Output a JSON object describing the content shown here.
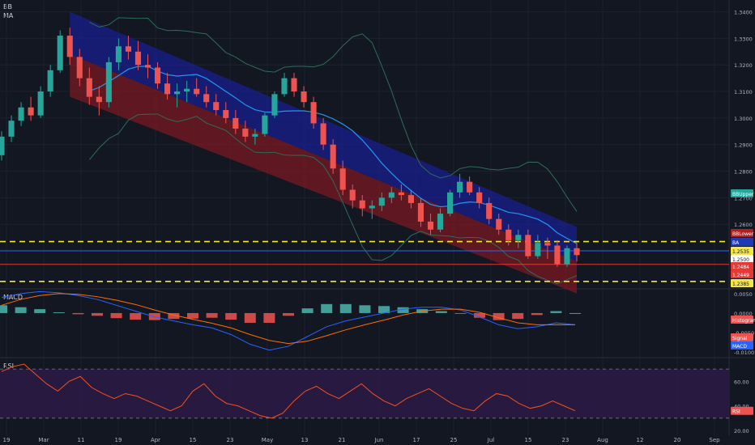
{
  "panes": {
    "price": {
      "labels": [
        "BB",
        "MA"
      ]
    },
    "macd": {
      "label": "MACD"
    },
    "rsi": {
      "label": "RSI"
    }
  },
  "x_axis": {
    "ticks": [
      "19",
      "Mar",
      "11",
      "19",
      "Apr",
      "15",
      "23",
      "May",
      "13",
      "21",
      "Jun",
      "17",
      "25",
      "Jul",
      "15",
      "23",
      "Aug",
      "12",
      "20",
      "Sep"
    ]
  },
  "price_axis": {
    "ticks": [
      "1.3400",
      "1.3300",
      "1.3200",
      "1.3100",
      "1.3000",
      "1.2900",
      "1.2800",
      "1.2700",
      "1.2600",
      "1.2500"
    ]
  },
  "macd_axis": {
    "ticks": [
      "0.0050",
      "0.0000",
      "-0.0050",
      "-0.0100"
    ]
  },
  "rsi_axis": {
    "ticks": [
      "60.00",
      "40.00",
      "20.00"
    ]
  },
  "badges": {
    "price": [
      {
        "text": "BBUpper",
        "bg": "#26a69a"
      },
      {
        "text": "BBLower",
        "bg": "#b71c1c"
      },
      {
        "text": "BA",
        "bg": "#1e3bb3"
      },
      {
        "text": "1.2535",
        "bg": "#f5e642"
      },
      {
        "text": "1.2500",
        "bg": "#ffffff"
      },
      {
        "text": "1.2484",
        "bg": "#e53935"
      },
      {
        "text": "1.2449",
        "bg": "#e53935"
      },
      {
        "text": "1.2385",
        "bg": "#f5e642"
      }
    ],
    "macd": [
      {
        "text": "Histogram",
        "bg": "#ef5350"
      },
      {
        "text": "Signal",
        "bg": "#ef5350"
      },
      {
        "text": "MACD",
        "bg": "#2962ff"
      }
    ],
    "rsi": [
      {
        "text": "RSI",
        "bg": "#ef5350"
      }
    ]
  },
  "colors": {
    "background": "#131722",
    "bull": "#26a69a",
    "bear": "#ef5350",
    "upper_channel": "#1a1f8f",
    "lower_channel": "#7a1a22",
    "bb_line": "#2e6b58",
    "ma_line": "#2196f3",
    "macd_line": "#2962ff",
    "signal_line": "#ff6d00",
    "rsi_line": "#f4511e",
    "rsi_band": "#2a1a44",
    "level_dashed": "#f5e642",
    "level_solid_blue": "#2962ff",
    "level_solid_red": "#e53935"
  },
  "chart_data": {
    "type": "candlestick",
    "symbol_pair_axis": "price",
    "ylim": [
      1.236,
      1.342
    ],
    "horizontal_levels": [
      {
        "value": 1.2535,
        "style": "dashed",
        "color": "#f5e642"
      },
      {
        "value": 1.25,
        "style": "solid",
        "color": "#2962ff"
      },
      {
        "value": 1.2449,
        "style": "solid",
        "color": "#e53935"
      },
      {
        "value": 1.2385,
        "style": "dashed",
        "color": "#f5e642"
      }
    ],
    "regression_channel": {
      "start": {
        "date": "Mar 11",
        "upper": 1.34,
        "mid": 1.324,
        "lower": 1.308
      },
      "end": {
        "date": "Jul 23",
        "upper": 1.259,
        "mid": 1.246,
        "lower": 1.234
      }
    },
    "ohlc": [
      [
        1.286,
        1.295,
        1.284,
        1.293
      ],
      [
        1.293,
        1.301,
        1.291,
        1.299
      ],
      [
        1.299,
        1.306,
        1.297,
        1.304
      ],
      [
        1.304,
        1.308,
        1.299,
        1.301
      ],
      [
        1.301,
        1.312,
        1.3,
        1.31
      ],
      [
        1.31,
        1.32,
        1.308,
        1.318
      ],
      [
        1.318,
        1.333,
        1.317,
        1.331
      ],
      [
        1.331,
        1.334,
        1.32,
        1.323
      ],
      [
        1.323,
        1.326,
        1.312,
        1.315
      ],
      [
        1.315,
        1.319,
        1.305,
        1.308
      ],
      [
        1.308,
        1.312,
        1.301,
        1.306
      ],
      [
        1.306,
        1.323,
        1.304,
        1.321
      ],
      [
        1.321,
        1.33,
        1.318,
        1.327
      ],
      [
        1.327,
        1.331,
        1.322,
        1.325
      ],
      [
        1.325,
        1.329,
        1.318,
        1.32
      ],
      [
        1.32,
        1.324,
        1.315,
        1.319
      ],
      [
        1.319,
        1.321,
        1.311,
        1.313
      ],
      [
        1.313,
        1.317,
        1.307,
        1.309
      ],
      [
        1.309,
        1.313,
        1.304,
        1.31
      ],
      [
        1.31,
        1.314,
        1.306,
        1.311
      ],
      [
        1.311,
        1.315,
        1.308,
        1.309
      ],
      [
        1.309,
        1.312,
        1.304,
        1.306
      ],
      [
        1.306,
        1.309,
        1.301,
        1.303
      ],
      [
        1.303,
        1.306,
        1.298,
        1.3
      ],
      [
        1.3,
        1.303,
        1.294,
        1.296
      ],
      [
        1.296,
        1.299,
        1.291,
        1.293
      ],
      [
        1.293,
        1.296,
        1.29,
        1.294
      ],
      [
        1.294,
        1.302,
        1.293,
        1.301
      ],
      [
        1.301,
        1.31,
        1.3,
        1.309
      ],
      [
        1.309,
        1.317,
        1.308,
        1.315
      ],
      [
        1.315,
        1.317,
        1.308,
        1.31
      ],
      [
        1.31,
        1.312,
        1.304,
        1.306
      ],
      [
        1.306,
        1.308,
        1.296,
        1.298
      ],
      [
        1.298,
        1.3,
        1.288,
        1.29
      ],
      [
        1.29,
        1.292,
        1.279,
        1.281
      ],
      [
        1.281,
        1.284,
        1.271,
        1.273
      ],
      [
        1.273,
        1.275,
        1.266,
        1.269
      ],
      [
        1.269,
        1.271,
        1.263,
        1.266
      ],
      [
        1.266,
        1.269,
        1.262,
        1.267
      ],
      [
        1.267,
        1.272,
        1.265,
        1.27
      ],
      [
        1.27,
        1.274,
        1.268,
        1.272
      ],
      [
        1.272,
        1.275,
        1.269,
        1.271
      ],
      [
        1.271,
        1.273,
        1.266,
        1.268
      ],
      [
        1.268,
        1.27,
        1.259,
        1.261
      ],
      [
        1.261,
        1.264,
        1.256,
        1.258
      ],
      [
        1.258,
        1.266,
        1.257,
        1.264
      ],
      [
        1.264,
        1.273,
        1.263,
        1.272
      ],
      [
        1.272,
        1.279,
        1.27,
        1.276
      ],
      [
        1.276,
        1.278,
        1.271,
        1.272
      ],
      [
        1.272,
        1.274,
        1.266,
        1.268
      ],
      [
        1.268,
        1.27,
        1.26,
        1.262
      ],
      [
        1.262,
        1.264,
        1.256,
        1.258
      ],
      [
        1.258,
        1.26,
        1.252,
        1.254
      ],
      [
        1.254,
        1.258,
        1.251,
        1.256
      ],
      [
        1.256,
        1.258,
        1.247,
        1.248
      ],
      [
        1.248,
        1.256,
        1.247,
        1.253
      ],
      [
        1.253,
        1.255,
        1.247,
        1.252
      ],
      [
        1.252,
        1.254,
        1.244,
        1.245
      ],
      [
        1.245,
        1.252,
        1.244,
        1.251
      ],
      [
        1.251,
        1.253,
        1.246,
        1.2484
      ]
    ],
    "macd": {
      "macd": [
        0.004,
        0.005,
        0.0055,
        0.0052,
        0.0045,
        0.0035,
        0.002,
        0.0005,
        -0.001,
        -0.002,
        -0.003,
        -0.0038,
        -0.0055,
        -0.008,
        -0.0095,
        -0.0085,
        -0.006,
        -0.0035,
        -0.002,
        -0.001,
        0.0,
        0.001,
        0.0015,
        0.0015,
        0.0008,
        -0.001,
        -0.003,
        -0.004,
        -0.0035,
        -0.0025,
        -0.003
      ],
      "signal": [
        0.002,
        0.0035,
        0.0045,
        0.005,
        0.0048,
        0.0042,
        0.0033,
        0.0022,
        0.0008,
        -0.0005,
        -0.0016,
        -0.0026,
        -0.0038,
        -0.0055,
        -0.007,
        -0.0078,
        -0.0072,
        -0.0058,
        -0.0043,
        -0.003,
        -0.0018,
        -0.0005,
        0.0005,
        0.001,
        0.001,
        0.0002,
        -0.0012,
        -0.0025,
        -0.003,
        -0.003,
        -0.003
      ],
      "ylim": [
        -0.011,
        0.006
      ]
    },
    "rsi": {
      "values": [
        68,
        72,
        74,
        66,
        58,
        52,
        60,
        64,
        55,
        50,
        46,
        50,
        48,
        44,
        40,
        36,
        40,
        52,
        58,
        48,
        42,
        40,
        36,
        32,
        30,
        34,
        44,
        52,
        56,
        50,
        46,
        52,
        58,
        50,
        44,
        40,
        46,
        50,
        54,
        48,
        42,
        38,
        36,
        44,
        50,
        48,
        42,
        38,
        40,
        44,
        40,
        36
      ],
      "overbought": 70,
      "oversold": 30,
      "ylim": [
        18,
        78
      ]
    }
  }
}
